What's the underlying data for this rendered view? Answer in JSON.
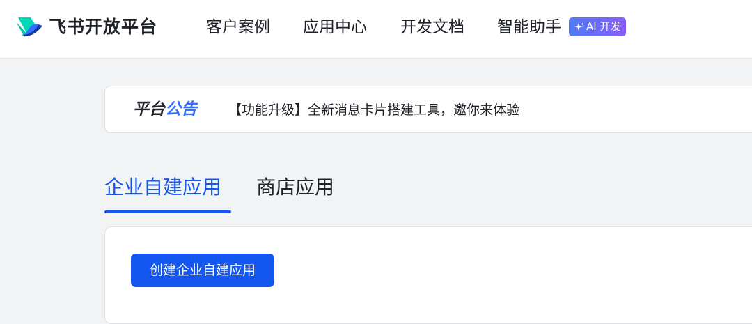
{
  "header": {
    "logo_text": "飞书开放平台",
    "logo_icon": "feishu-logo-icon",
    "nav": [
      {
        "label": "客户案例"
      },
      {
        "label": "应用中心"
      },
      {
        "label": "开发文档"
      },
      {
        "label": "智能助手"
      }
    ],
    "ai_badge": {
      "icon": "sparkle-icon",
      "label": "AI 开发"
    }
  },
  "notice": {
    "title_part1": "平台",
    "title_part2": "公告",
    "text": "【功能升级】全新消息卡片搭建工具，邀你来体验"
  },
  "tabs": [
    {
      "label": "企业自建应用",
      "active": true
    },
    {
      "label": "商店应用",
      "active": false
    }
  ],
  "actions": {
    "create_label": "创建企业自建应用"
  },
  "colors": {
    "accent": "#1456f0",
    "notice_highlight": "#3370ff",
    "badge_gradient_start": "#4e7bf5",
    "badge_gradient_end": "#8a5cf6",
    "page_background": "#f2f3f5"
  }
}
